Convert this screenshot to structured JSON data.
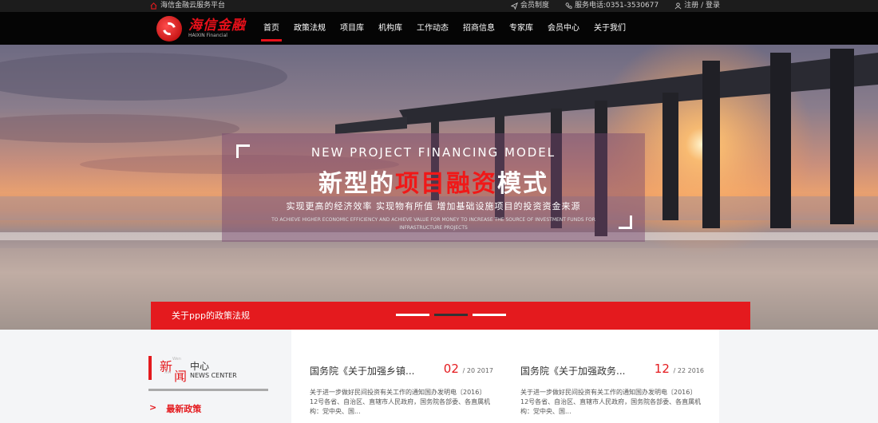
{
  "topbar": {
    "platform": "海信金融云服务平台",
    "membership": "会员制度",
    "phone": "服务电话:0351-3530677",
    "auth": "注册 / 登录"
  },
  "logo": {
    "cn": "海信金融",
    "en": "HAIXIN Financial"
  },
  "nav": {
    "items": [
      "首页",
      "政策法规",
      "项目库",
      "机构库",
      "工作动态",
      "招商信息",
      "专家库",
      "会员中心",
      "关于我们"
    ],
    "active": "首页"
  },
  "hero": {
    "en_title": "NEW PROJECT FINANCING MODEL",
    "cn_title_pre": "新型的",
    "cn_title_hl": "项目融资",
    "cn_title_post": "模式",
    "subtitle": "实现更高的经济效率   实现物有所值   增加基础设施项目的投资资金来源",
    "subtitle_en": "TO ACHIEVE HIGHER ECONOMIC EFFICIENCY AND ACHIEVE VALUE FOR MONEY TO INCREASE THE SOURCE OF INVESTMENT FUNDS FOR INFRASTRUCTURE PROJECTS"
  },
  "banner": {
    "label": "关于ppp的政策法规",
    "slides": 3,
    "active_slide": 2
  },
  "news": {
    "char1": "新",
    "char2": "闻",
    "en1": "Wen",
    "en2": "Xin",
    "cn": "中心",
    "en": "NEWS CENTER",
    "latest_arrow": ">",
    "latest_label": "最新政策"
  },
  "cards": [
    {
      "title": "国务院《关于加强乡镇...",
      "day": "02",
      "date_rest": "/ 20 2017",
      "desc": "关于进一步做好民间投资有关工作的通知国办发明电〔2016〕12号各省、自治区、直辖市人民政府，国务院各部委、各直属机构：党中央、国..."
    },
    {
      "title": "国务院《关于加强政务...",
      "day": "12",
      "date_rest": "/ 22 2016",
      "desc": "关于进一步做好民间投资有关工作的通知国办发明电〔2016〕12号各省、自治区、直辖市人民政府，国务院各部委、各直属机构：党中央、国..."
    }
  ],
  "colors": {
    "accent": "#e41a1e",
    "nav_bg": "#050505",
    "topbar_bg": "#1c1c1c"
  }
}
